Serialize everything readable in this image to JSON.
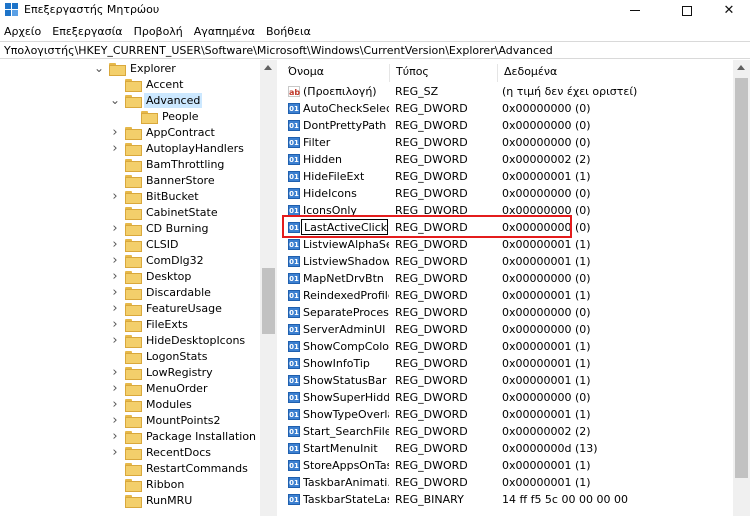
{
  "window": {
    "title": "Επεξεργαστής Μητρώου"
  },
  "menu": [
    "Αρχείο",
    "Επεξεργασία",
    "Προβολή",
    "Αγαπημένα",
    "Βοήθεια"
  ],
  "address": "Υπολογιστής\\HKEY_CURRENT_USER\\Software\\Microsoft\\Windows\\CurrentVersion\\Explorer\\Advanced",
  "tree": {
    "items": [
      {
        "label": "Explorer",
        "level": 0,
        "arrow": "open"
      },
      {
        "label": "Accent",
        "level": 1,
        "arrow": "none"
      },
      {
        "label": "Advanced",
        "level": 1,
        "arrow": "open",
        "selected": true
      },
      {
        "label": "People",
        "level": 2,
        "arrow": "none"
      },
      {
        "label": "AppContract",
        "level": 1,
        "arrow": "closed"
      },
      {
        "label": "AutoplayHandlers",
        "level": 1,
        "arrow": "closed"
      },
      {
        "label": "BamThrottling",
        "level": 1,
        "arrow": "none"
      },
      {
        "label": "BannerStore",
        "level": 1,
        "arrow": "none"
      },
      {
        "label": "BitBucket",
        "level": 1,
        "arrow": "closed"
      },
      {
        "label": "CabinetState",
        "level": 1,
        "arrow": "none"
      },
      {
        "label": "CD Burning",
        "level": 1,
        "arrow": "closed"
      },
      {
        "label": "CLSID",
        "level": 1,
        "arrow": "closed"
      },
      {
        "label": "ComDlg32",
        "level": 1,
        "arrow": "closed"
      },
      {
        "label": "Desktop",
        "level": 1,
        "arrow": "closed"
      },
      {
        "label": "Discardable",
        "level": 1,
        "arrow": "closed"
      },
      {
        "label": "FeatureUsage",
        "level": 1,
        "arrow": "closed"
      },
      {
        "label": "FileExts",
        "level": 1,
        "arrow": "closed"
      },
      {
        "label": "HideDesktopIcons",
        "level": 1,
        "arrow": "closed"
      },
      {
        "label": "LogonStats",
        "level": 1,
        "arrow": "none"
      },
      {
        "label": "LowRegistry",
        "level": 1,
        "arrow": "closed"
      },
      {
        "label": "MenuOrder",
        "level": 1,
        "arrow": "closed"
      },
      {
        "label": "Modules",
        "level": 1,
        "arrow": "closed"
      },
      {
        "label": "MountPoints2",
        "level": 1,
        "arrow": "closed"
      },
      {
        "label": "Package Installation",
        "level": 1,
        "arrow": "closed"
      },
      {
        "label": "RecentDocs",
        "level": 1,
        "arrow": "closed"
      },
      {
        "label": "RestartCommands",
        "level": 1,
        "arrow": "none"
      },
      {
        "label": "Ribbon",
        "level": 1,
        "arrow": "none"
      },
      {
        "label": "RunMRU",
        "level": 1,
        "arrow": "none"
      }
    ]
  },
  "columns": {
    "name": "Όνομα",
    "type": "Τύπος",
    "data": "Δεδομένα"
  },
  "values": [
    {
      "name": "(Προεπιλογή)",
      "type": "REG_SZ",
      "data": "(η τιμή δεν έχει οριστεί)",
      "icon": "string"
    },
    {
      "name": "AutoCheckSelect",
      "type": "REG_DWORD",
      "data": "0x00000000 (0)",
      "icon": "binary"
    },
    {
      "name": "DontPrettyPath",
      "type": "REG_DWORD",
      "data": "0x00000000 (0)",
      "icon": "binary"
    },
    {
      "name": "Filter",
      "type": "REG_DWORD",
      "data": "0x00000000 (0)",
      "icon": "binary"
    },
    {
      "name": "Hidden",
      "type": "REG_DWORD",
      "data": "0x00000002 (2)",
      "icon": "binary"
    },
    {
      "name": "HideFileExt",
      "type": "REG_DWORD",
      "data": "0x00000001 (1)",
      "icon": "binary"
    },
    {
      "name": "HideIcons",
      "type": "REG_DWORD",
      "data": "0x00000000 (0)",
      "icon": "binary"
    },
    {
      "name": "IconsOnly",
      "type": "REG_DWORD",
      "data": "0x00000000 (0)",
      "icon": "binary"
    },
    {
      "name": "LastActiveClick",
      "type": "REG_DWORD",
      "data": "0x00000000 (0)",
      "icon": "binary",
      "editing": true
    },
    {
      "name": "ListviewAlphaSe...",
      "type": "REG_DWORD",
      "data": "0x00000001 (1)",
      "icon": "binary"
    },
    {
      "name": "ListviewShadow",
      "type": "REG_DWORD",
      "data": "0x00000001 (1)",
      "icon": "binary"
    },
    {
      "name": "MapNetDrvBtn",
      "type": "REG_DWORD",
      "data": "0x00000000 (0)",
      "icon": "binary"
    },
    {
      "name": "ReindexedProfile",
      "type": "REG_DWORD",
      "data": "0x00000001 (1)",
      "icon": "binary"
    },
    {
      "name": "SeparateProcess",
      "type": "REG_DWORD",
      "data": "0x00000000 (0)",
      "icon": "binary"
    },
    {
      "name": "ServerAdminUI",
      "type": "REG_DWORD",
      "data": "0x00000000 (0)",
      "icon": "binary"
    },
    {
      "name": "ShowCompColor",
      "type": "REG_DWORD",
      "data": "0x00000001 (1)",
      "icon": "binary"
    },
    {
      "name": "ShowInfoTip",
      "type": "REG_DWORD",
      "data": "0x00000001 (1)",
      "icon": "binary"
    },
    {
      "name": "ShowStatusBar",
      "type": "REG_DWORD",
      "data": "0x00000001 (1)",
      "icon": "binary"
    },
    {
      "name": "ShowSuperHidd...",
      "type": "REG_DWORD",
      "data": "0x00000000 (0)",
      "icon": "binary"
    },
    {
      "name": "ShowTypeOverlay",
      "type": "REG_DWORD",
      "data": "0x00000001 (1)",
      "icon": "binary"
    },
    {
      "name": "Start_SearchFiles",
      "type": "REG_DWORD",
      "data": "0x00000002 (2)",
      "icon": "binary"
    },
    {
      "name": "StartMenuInit",
      "type": "REG_DWORD",
      "data": "0x0000000d (13)",
      "icon": "binary"
    },
    {
      "name": "StoreAppsOnTas...",
      "type": "REG_DWORD",
      "data": "0x00000001 (1)",
      "icon": "binary"
    },
    {
      "name": "TaskbarAnimati...",
      "type": "REG_DWORD",
      "data": "0x00000001 (1)",
      "icon": "binary"
    },
    {
      "name": "TaskbarStateLast...",
      "type": "REG_BINARY",
      "data": "14 ff f5 5c 00 00 00 00",
      "icon": "binary"
    }
  ],
  "colors": {
    "selection": "#cce8ff",
    "highlight": "#e41c1c",
    "folder": "#f3cf6b"
  }
}
